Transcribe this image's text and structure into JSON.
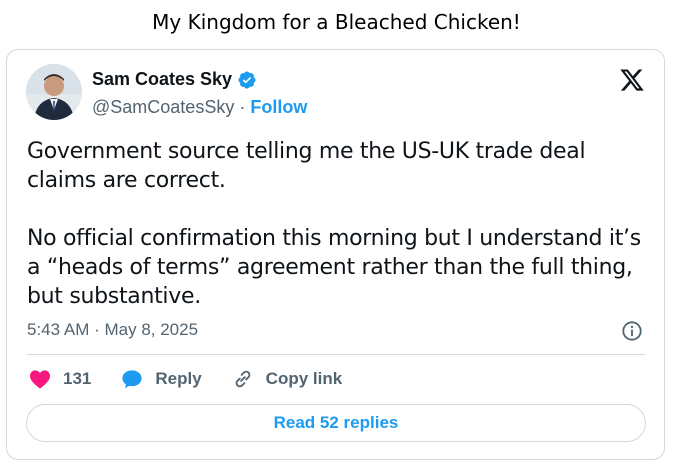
{
  "page": {
    "title": "My Kingdom for a Bleached Chicken!"
  },
  "tweet": {
    "author_name": "Sam Coates Sky",
    "handle": "@SamCoatesSky",
    "separator": " · ",
    "follow_label": "Follow",
    "text": "Government source telling me the US-UK trade deal\nclaims are correct.\n\nNo official confirmation this morning but I understand it’s\na “heads of terms” agreement rather than the full thing,\nbut substantive.",
    "timestamp": "5:43 AM · May 8, 2025",
    "like_count": "131",
    "reply_label": "Reply",
    "copy_link_label": "Copy link",
    "read_replies_label": "Read 52 replies"
  },
  "colors": {
    "accent": "#1d9bf0",
    "like": "#f91880",
    "muted": "#536471",
    "border": "#cfd9de"
  },
  "icons": [
    "verified-badge-icon",
    "x-logo-icon",
    "info-icon",
    "heart-icon",
    "reply-bubble-icon",
    "link-icon"
  ]
}
